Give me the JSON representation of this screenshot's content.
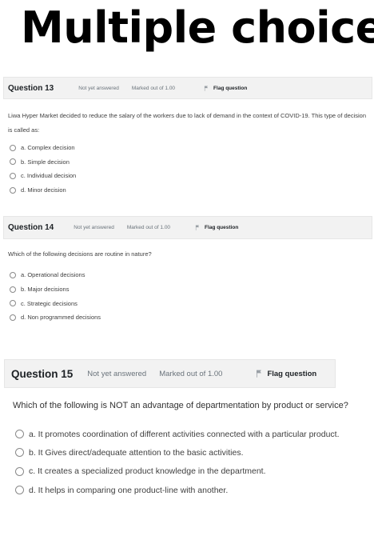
{
  "page": {
    "title": "Multiple choice"
  },
  "questions": [
    {
      "number": "Question 13",
      "state": "Not yet answered",
      "grade": "Marked out of 1.00",
      "flag_label": "Flag question",
      "text": "Liwa Hyper Market decided to reduce the salary of the workers due to lack of demand in the context of COVID-19. This type of decision is called as:",
      "options": [
        "a. Complex decision",
        "b. Simple decision",
        "c. Individual decision",
        "d. Minor decision"
      ]
    },
    {
      "number": "Question 14",
      "state": "Not yet answered",
      "grade": "Marked out of 1.00",
      "flag_label": "Flag question",
      "text": "Which of the following decisions are routine in nature?",
      "options": [
        "a. Operational decisions",
        "b. Major decisions",
        "c. Strategic decisions",
        "d. Non programmed decisions"
      ]
    },
    {
      "number": "Question 15",
      "state": "Not yet answered",
      "grade": "Marked out of 1.00",
      "flag_label": "Flag question",
      "text": "Which of the following is NOT an advantage of departmentation by product or service?",
      "options": [
        "a. It promotes coordination of different activities connected with a particular product.",
        "b. It Gives direct/adequate attention to the basic activities.",
        "c. It creates a specialized product knowledge in the department.",
        "d. It helps in comparing one product-line with another."
      ]
    }
  ]
}
